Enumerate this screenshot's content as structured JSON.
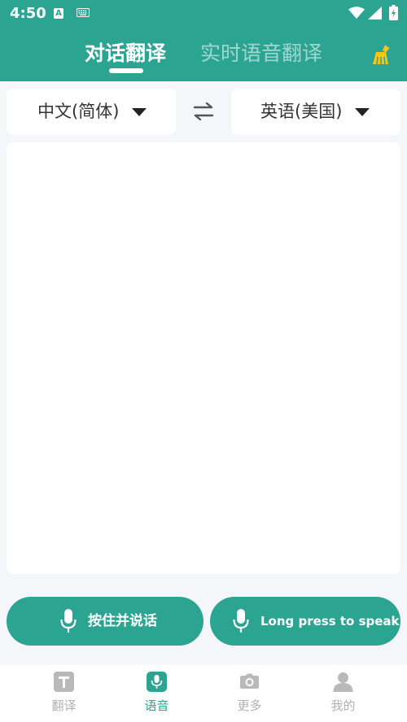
{
  "status_bar": {
    "time": "4:50",
    "notification_badge": "A"
  },
  "header": {
    "tabs": [
      {
        "label": "对话翻译",
        "active": true
      },
      {
        "label": "实时语音翻译",
        "active": false
      }
    ],
    "clear_icon": "broom-icon"
  },
  "languages": {
    "source": "中文(简体)",
    "target": "英语(美国)",
    "swap_icon": "swap-arrows-icon"
  },
  "mic_buttons": {
    "source_label": "按住并说话",
    "target_label": "Long press to speak"
  },
  "bottom_nav": {
    "items": [
      {
        "label": "翻译",
        "icon": "text-icon",
        "active": false
      },
      {
        "label": "语音",
        "icon": "microphone-icon",
        "active": true
      },
      {
        "label": "更多",
        "icon": "camera-icon",
        "active": false
      },
      {
        "label": "我的",
        "icon": "person-icon",
        "active": false
      }
    ]
  },
  "colors": {
    "primary": "#2ba592",
    "background": "#f4f6f9",
    "inactive": "#b0b0b0",
    "accent_icon": "#f5c518"
  }
}
